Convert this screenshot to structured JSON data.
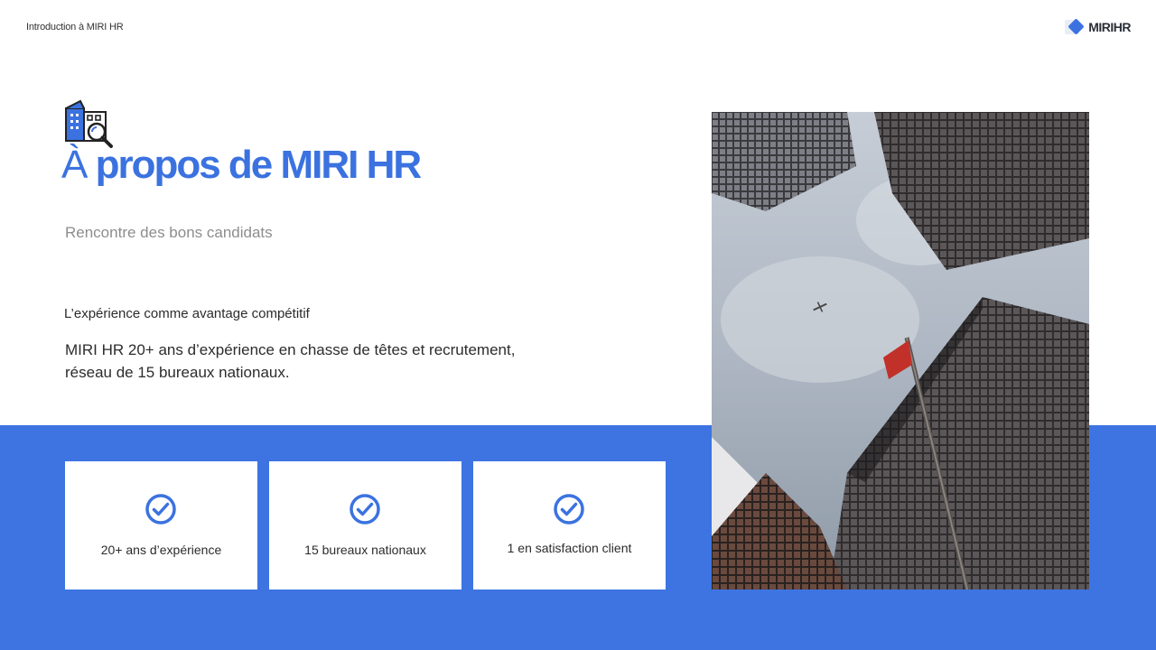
{
  "header": {
    "breadcrumb": "Introduction à MIRI HR",
    "logo_text": "MIRIHR",
    "logo_icon": "diamond-icon"
  },
  "title": {
    "icon": "building-search-icon",
    "prefix": "À",
    "rest": "propos de MIRI HR"
  },
  "subtitle": "Rencontre des bons candidats",
  "section": {
    "heading": "L’expérience comme avantage compétitif",
    "body": "MIRI HR 20+ ans d’expérience en chasse de têtes et recrutement,\n réseau de 15 bureaux nationaux."
  },
  "cards": [
    {
      "icon": "check-circle-icon",
      "label": "20+ ans d’expérience"
    },
    {
      "icon": "check-circle-icon",
      "label": "15 bureaux nationaux"
    },
    {
      "icon": "check-circle-icon",
      "label": "1 en satisfaction client"
    }
  ],
  "colors": {
    "accent": "#3b72e0",
    "band": "#3d74e2",
    "text": "#2c2c2c",
    "subtitle": "#8d8d8d"
  }
}
